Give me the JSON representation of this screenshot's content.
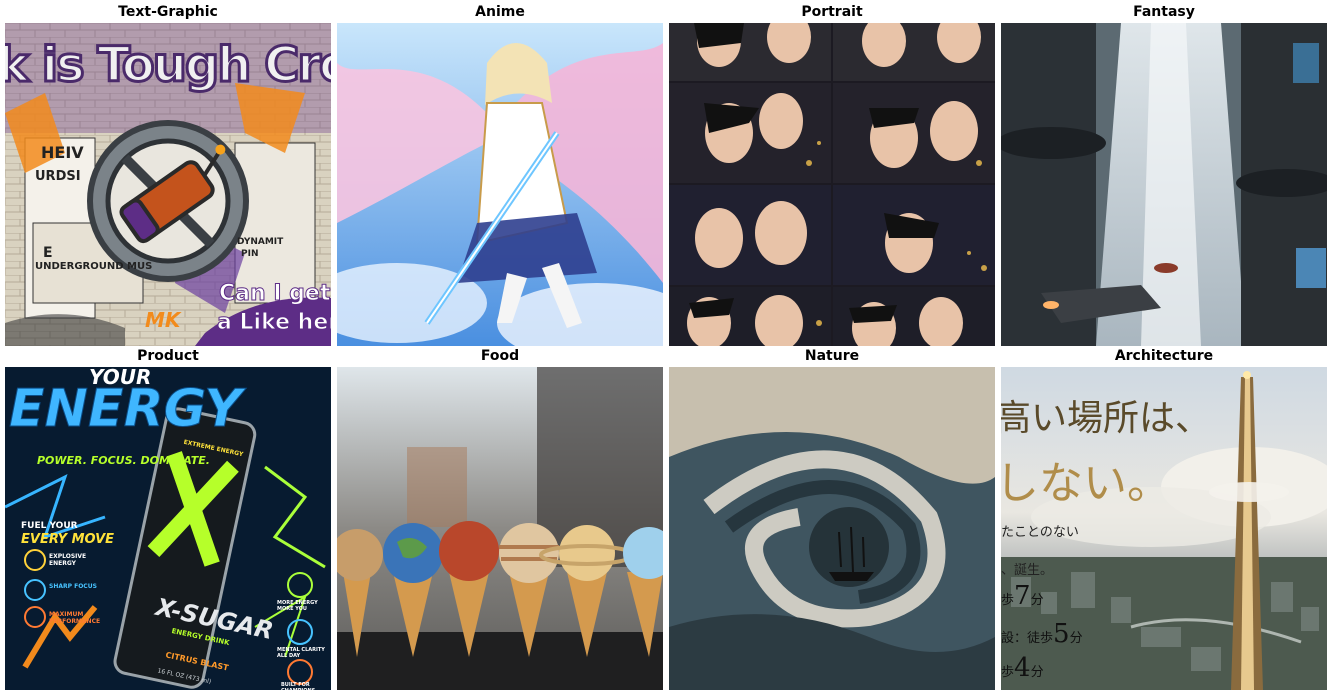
{
  "panels": [
    {
      "title": "Text-Graphic"
    },
    {
      "title": "Anime"
    },
    {
      "title": "Portrait"
    },
    {
      "title": "Fantasy"
    },
    {
      "title": "Product"
    },
    {
      "title": "Food"
    },
    {
      "title": "Nature"
    },
    {
      "title": "Architecture"
    }
  ],
  "textgraphic": {
    "headline": "k is Tough Cro",
    "sign_line1": "Can I get",
    "sign_line2": "a Like here",
    "poster1": "HEIV",
    "poster2": "URDSI",
    "poster3": "DYNAMIT",
    "poster4": "PIN",
    "poster5": "UNDERGROUND MUS",
    "poster6": "E",
    "tag": "MK"
  },
  "product": {
    "headline_small": "YOUR",
    "headline": "ENERGY",
    "slogan": "POWER. FOCUS. DOMINATE.",
    "fuel1": "FUEL YOUR",
    "fuel2": "EVERY MOVE",
    "feat1": "EXPLOSIVE ENERGY",
    "feat2": "SHARP FOCUS",
    "feat3": "MAXIMUM PERFORMANCE",
    "right1": "MORE ENERGY MORE YOU",
    "right2": "MENTAL CLARITY ALL DAY",
    "right3": "BUILT FOR CHAMPIONS",
    "can_top": "EXTREME ENERGY",
    "brand": "X-SUGAR",
    "sub": "ENERGY DRINK",
    "flavor": "CITRUS BLAST",
    "volume": "16 FL OZ (473 ml)"
  },
  "architecture": {
    "line1": "高い場所は、",
    "line2": "しない。",
    "line3": "たことのない",
    "line4": "、誕生。",
    "line5a": "歩",
    "line5b": "7",
    "line5c": "分",
    "line6a": "設：徒歩",
    "line6b": "5",
    "line6c": "分",
    "line7a": "歩",
    "line7b": "4",
    "line7c": "分"
  }
}
